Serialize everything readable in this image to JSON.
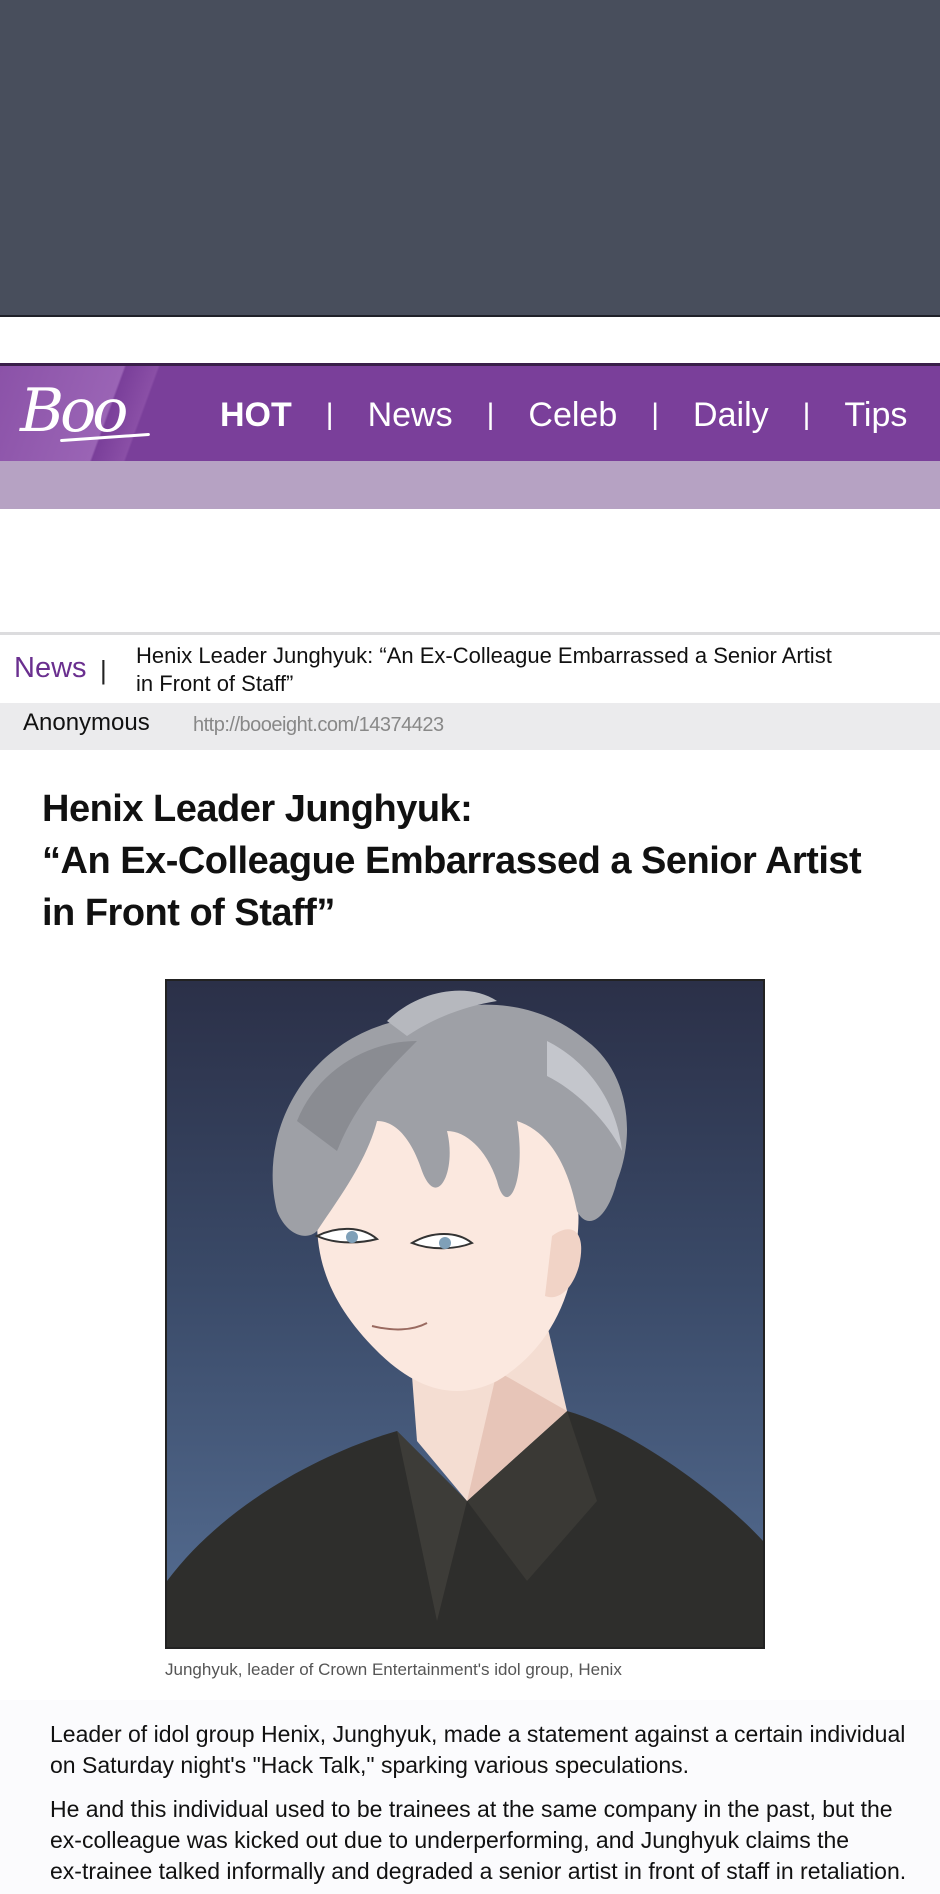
{
  "site": {
    "logo": "Boo",
    "nav": [
      "HOT",
      "News",
      "Celeb",
      "Daily",
      "Tips"
    ],
    "nav_separator": "|",
    "accent_color": "#7a3f9a"
  },
  "breadcrumb": {
    "section": "News",
    "separator": "|",
    "title_lines": [
      "Henix Leader Junghyuk: “An Ex-Colleague Embarrassed a Senior Artist",
      "in Front of Staff”"
    ]
  },
  "meta": {
    "author": "Anonymous",
    "url": "http://booeight.com/14374423"
  },
  "article": {
    "headline_lines": [
      "Henix Leader Junghyuk:",
      "“An Ex-Colleague Embarrassed a Senior Artist",
      "in Front of Staff”"
    ],
    "image_caption": "Junghyuk, leader of Crown Entertainment's idol group, Henix",
    "paragraphs": [
      [
        "Leader of idol group Henix, Junghyuk, made a statement against a certain individual",
        "on Saturday night's \"Hack Talk,\" sparking various speculations."
      ],
      [
        "He and this individual used to be trainees at the same company in the past, but the",
        "ex-colleague was kicked out due to underperforming, and Junghyuk claims the",
        "ex-trainee talked informally and degraded a senior artist in front of staff in retaliation."
      ]
    ]
  }
}
